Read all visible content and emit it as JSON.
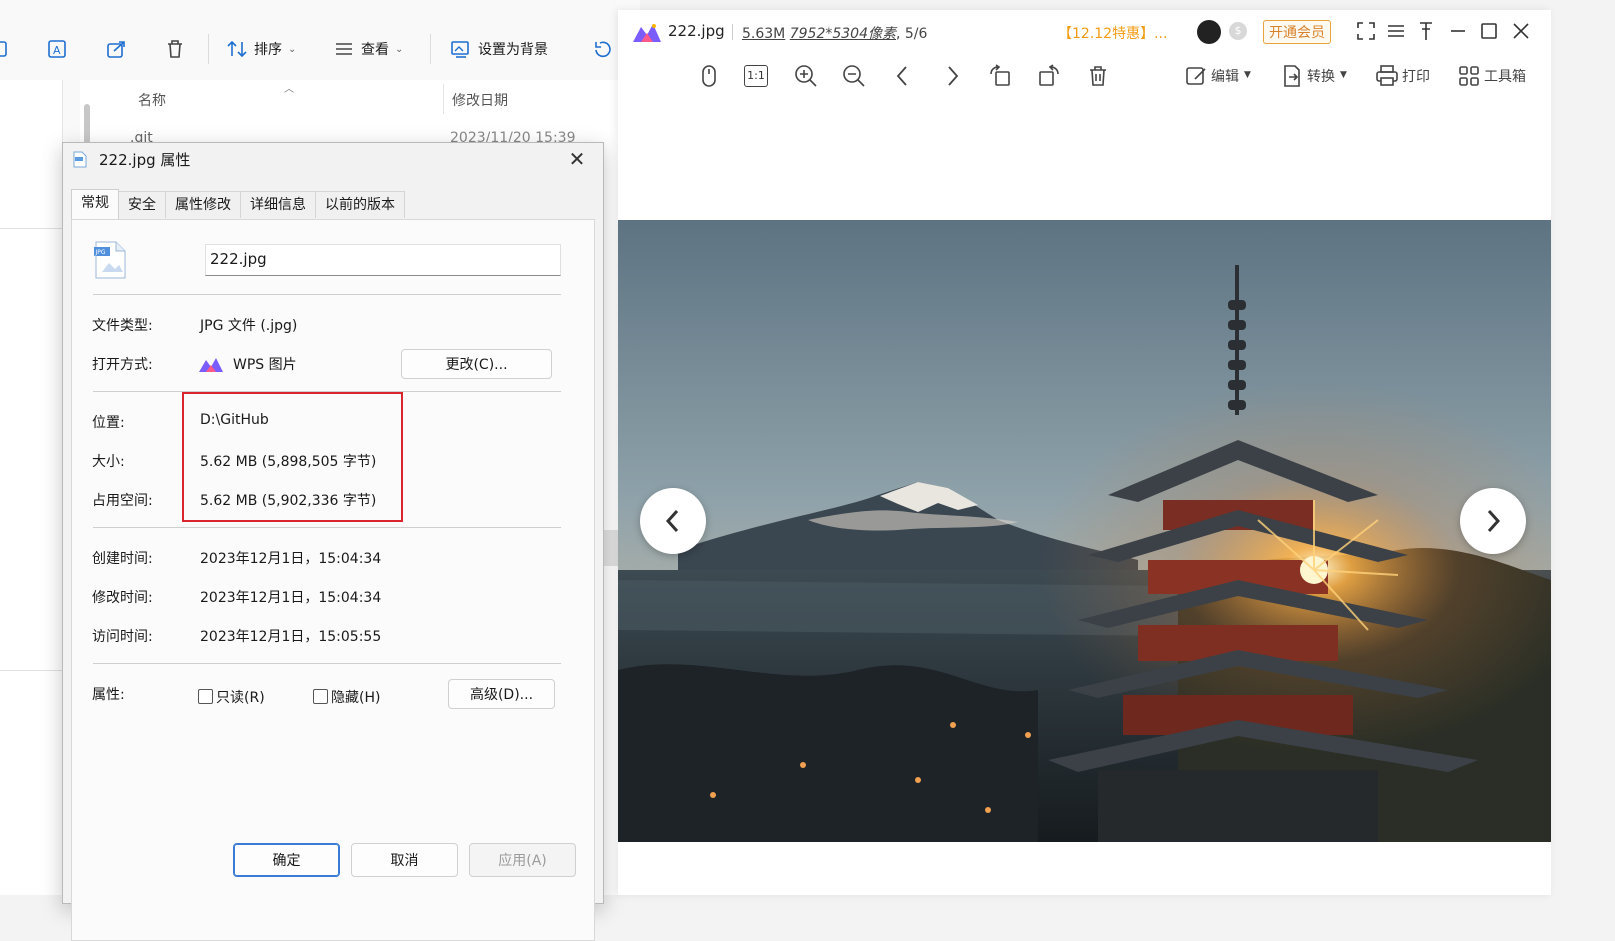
{
  "explorer": {
    "toolbar": {
      "sort_label": "排序",
      "view_label": "查看",
      "set_bg_label": "设置为背景"
    },
    "columns": {
      "name": "名称",
      "modified": "修改日期"
    },
    "partial_row": {
      "name": ".git",
      "date": "2023/11/20 15:39"
    }
  },
  "dialog": {
    "title": "222.jpg 属性",
    "tabs": [
      "常规",
      "安全",
      "属性修改",
      "详细信息",
      "以前的版本"
    ],
    "active_tab": "常规",
    "filename": "222.jpg",
    "file_type_label": "文件类型:",
    "file_type_value": "JPG 文件 (.jpg)",
    "open_with_label": "打开方式:",
    "open_with_value": "WPS 图片",
    "change_button": "更改(C)...",
    "location_label": "位置:",
    "location_value": "D:\\GitHub",
    "size_label": "大小:",
    "size_value": "5.62 MB (5,898,505 字节)",
    "disk_size_label": "占用空间:",
    "disk_size_value": "5.62 MB (5,902,336 字节)",
    "created_label": "创建时间:",
    "created_value": "2023年12月1日，15:04:34",
    "modified_label": "修改时间:",
    "modified_value": "2023年12月1日，15:04:34",
    "accessed_label": "访问时间:",
    "accessed_value": "2023年12月1日，15:05:55",
    "attributes_label": "属性:",
    "readonly_label": "只读(R)",
    "hidden_label": "隐藏(H)",
    "advanced_button": "高级(D)...",
    "ok_button": "确定",
    "cancel_button": "取消",
    "apply_button": "应用(A)",
    "highlight_color": "#d9252d"
  },
  "viewer": {
    "title": "222.jpg",
    "size": "5.63M",
    "resolution": "7952*5304像素",
    "position": ", 5/6",
    "promo": "【12.12特惠】...",
    "vip_button": "开通会员",
    "toolbar": {
      "actual_size": "1:1",
      "edit": "编辑",
      "convert": "转换",
      "print": "打印",
      "toolbox": "工具箱"
    },
    "accent": "#7b5cff"
  }
}
